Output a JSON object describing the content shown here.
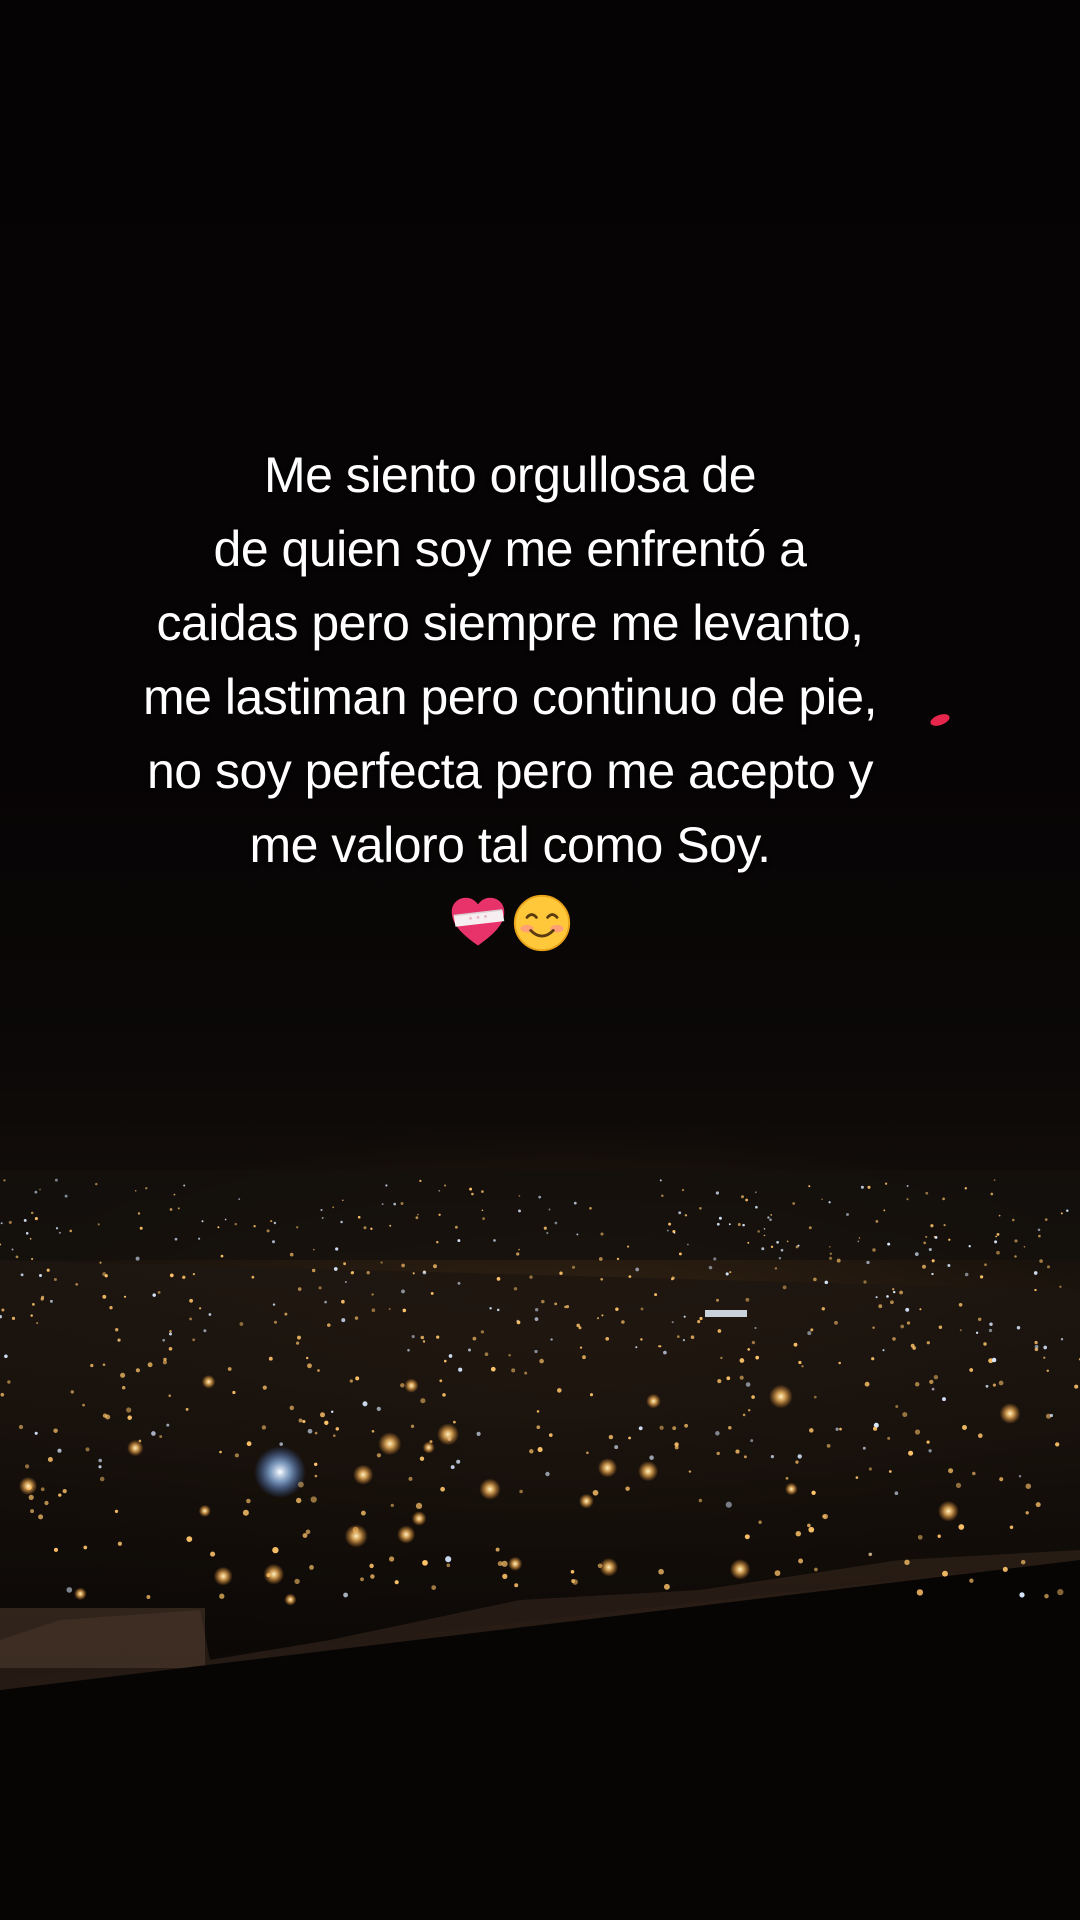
{
  "caption": {
    "lines": [
      "Me siento orgullosa de",
      "de quien soy me enfrentó a",
      "caidas pero siempre me levanto,",
      "me lastiman pero continuo de pie,",
      "no soy perfecta pero me acepto y",
      "me valoro tal como Soy."
    ],
    "emojis": [
      "mending-heart-icon",
      "smiling-face-icon"
    ]
  },
  "colors": {
    "sky": "#060404",
    "city_light_warm": "#ffc46a",
    "city_light_cool": "#cfe4ff",
    "accent_light": "#ff2a52"
  }
}
